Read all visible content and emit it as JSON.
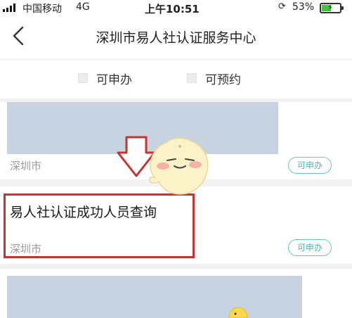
{
  "status_bar": {
    "carrier": "中国移动",
    "network": "4G",
    "time": "上午10:51",
    "battery_percent": "53%",
    "battery_level": 0.53
  },
  "nav": {
    "title": "深圳市易人社认证服务中心",
    "back_icon": "chevron-left-icon"
  },
  "filters": [
    {
      "label": "可申办",
      "checked": false
    },
    {
      "label": "可预约",
      "checked": false
    }
  ],
  "cards": [
    {
      "title": "",
      "city": "深圳市",
      "tag": "可申办"
    },
    {
      "title": "易人社认证成功人员查询",
      "city": "深圳市",
      "tag": "可申办"
    },
    {
      "title": "",
      "city": "",
      "tag": ""
    }
  ],
  "colors": {
    "tag_border": "#6ac6c6",
    "highlight": "#c7332f",
    "banner_placeholder": "#c8d3e2",
    "battery_fill": "#3ec63e"
  }
}
